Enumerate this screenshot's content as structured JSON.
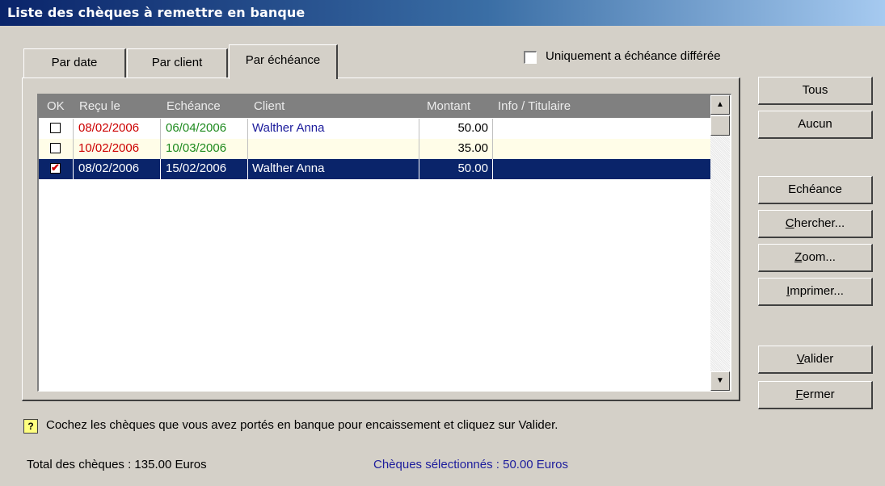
{
  "window": {
    "title": "Liste des chèques à remettre en banque"
  },
  "tabs": [
    {
      "label": "Par date"
    },
    {
      "label": "Par client"
    },
    {
      "label": "Par échéance"
    }
  ],
  "filter": {
    "label": "Uniquement a échéance différée",
    "checked": false
  },
  "list": {
    "columns": [
      "OK",
      "Reçu le",
      "Echéance",
      "Client",
      "Montant",
      "Info / Titulaire"
    ],
    "rows": [
      {
        "ok": false,
        "recu": "08/02/2006",
        "echeance": "06/04/2006",
        "client": "Walther Anna",
        "montant": "50.00",
        "info": ""
      },
      {
        "ok": false,
        "recu": "10/02/2006",
        "echeance": "10/03/2006",
        "client": "",
        "montant": "35.00",
        "info": ""
      },
      {
        "ok": true,
        "recu": "08/02/2006",
        "echeance": "15/02/2006",
        "client": "Walther Anna",
        "montant": "50.00",
        "info": ""
      }
    ]
  },
  "buttons": {
    "tous": "Tous",
    "aucun": "Aucun",
    "echeance": "Echéance",
    "chercher": {
      "key": "C",
      "rest": "hercher..."
    },
    "zoom": {
      "key": "Z",
      "rest": "oom..."
    },
    "imprimer": {
      "key": "I",
      "rest": "mprimer..."
    },
    "valider": {
      "key": "V",
      "rest": "alider"
    },
    "fermer": {
      "key": "F",
      "rest": "ermer"
    }
  },
  "footer": {
    "hint": "Cochez les chèques que vous avez portés en banque pour encaissement et cliquez sur Valider.",
    "total": "Total des chèques : 135.00 Euros",
    "selected": "Chèques sélectionnés : 50.00 Euros"
  },
  "colors": {
    "titlebar": "#0a246a",
    "selection": "#0a246a",
    "date_red": "#cc0000",
    "date_green": "#1e8a1e",
    "client_blue": "#1c1c9c"
  },
  "icons": {
    "hint": "help-question-icon",
    "check": "checkmark-icon",
    "scroll_up": "arrow-up-icon",
    "scroll_down": "arrow-down-icon"
  }
}
